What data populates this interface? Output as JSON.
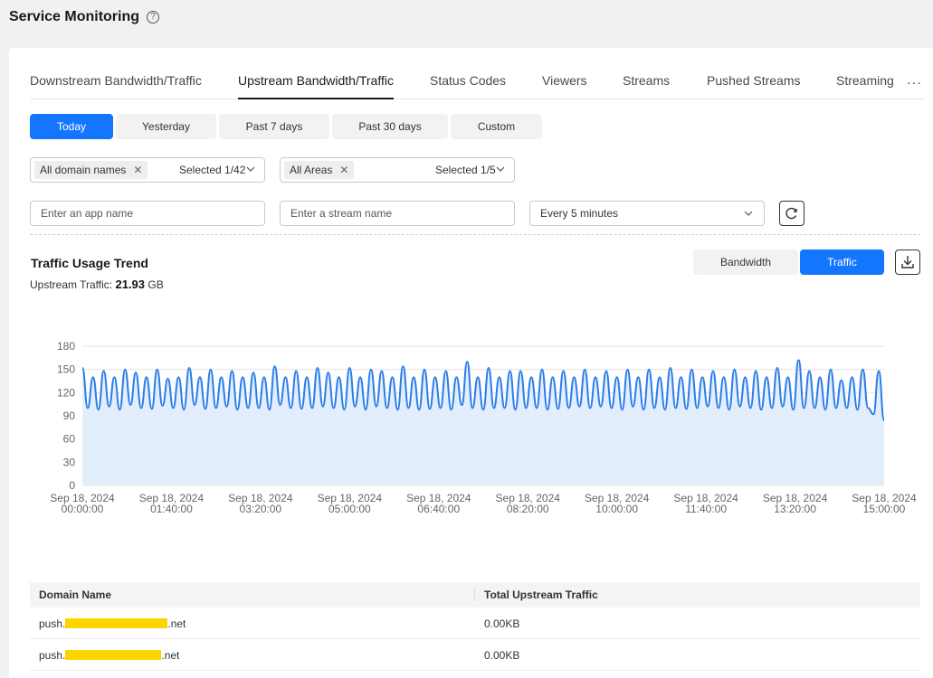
{
  "header": {
    "title": "Service Monitoring",
    "help_icon": "?"
  },
  "tabs": [
    {
      "label": "Downstream Bandwidth/Traffic",
      "active": false
    },
    {
      "label": "Upstream Bandwidth/Traffic",
      "active": true
    },
    {
      "label": "Status Codes",
      "active": false
    },
    {
      "label": "Viewers",
      "active": false
    },
    {
      "label": "Streams",
      "active": false
    },
    {
      "label": "Pushed Streams",
      "active": false
    },
    {
      "label": "Streaming",
      "active": false
    }
  ],
  "tabs_more": "···",
  "date_ranges": [
    {
      "label": "Today",
      "active": true
    },
    {
      "label": "Yesterday",
      "active": false
    },
    {
      "label": "Past 7 days",
      "active": false
    },
    {
      "label": "Past 30 days",
      "active": false
    },
    {
      "label": "Custom",
      "active": false
    }
  ],
  "filters": {
    "domain": {
      "tag": "All domain names",
      "selected": "Selected 1/42"
    },
    "area": {
      "tag": "All Areas",
      "selected": "Selected 1/5"
    },
    "app_placeholder": "Enter an app name",
    "stream_placeholder": "Enter a stream name",
    "interval": "Every 5 minutes"
  },
  "chart_section": {
    "title": "Traffic Usage Trend",
    "summary_label": "Upstream Traffic:",
    "summary_value": "21.93",
    "summary_unit": "GB",
    "toggle": [
      {
        "label": "Bandwidth",
        "active": false
      },
      {
        "label": "Traffic",
        "active": true
      }
    ]
  },
  "chart_data": {
    "type": "area",
    "title": "",
    "xlabel": "",
    "ylabel": "",
    "ylim": [
      0,
      180
    ],
    "yticks": [
      0,
      30,
      60,
      90,
      120,
      150,
      180
    ],
    "xticks": [
      {
        "date": "Sep 18, 2024",
        "time": "00:00:00"
      },
      {
        "date": "Sep 18, 2024",
        "time": "01:40:00"
      },
      {
        "date": "Sep 18, 2024",
        "time": "03:20:00"
      },
      {
        "date": "Sep 18, 2024",
        "time": "05:00:00"
      },
      {
        "date": "Sep 18, 2024",
        "time": "06:40:00"
      },
      {
        "date": "Sep 18, 2024",
        "time": "08:20:00"
      },
      {
        "date": "Sep 18, 2024",
        "time": "10:00:00"
      },
      {
        "date": "Sep 18, 2024",
        "time": "11:40:00"
      },
      {
        "date": "Sep 18, 2024",
        "time": "13:20:00"
      },
      {
        "date": "Sep 18, 2024",
        "time": "15:00:00"
      }
    ],
    "x_range": [
      "Sep 18, 2024 00:00:00",
      "Sep 18, 2024 15:00:00"
    ],
    "x_interval": "5 minutes",
    "grid": true,
    "color": "#2b7de9",
    "fill": "#e3eefc",
    "series": [
      {
        "values": [
          152,
          100,
          140,
          98,
          148,
          102,
          140,
          98,
          150,
          104,
          146,
          100,
          140,
          99,
          150,
          103,
          138,
          100,
          140,
          98,
          152,
          104,
          140,
          99,
          150,
          100,
          140,
          102,
          148,
          98,
          140,
          100,
          146,
          100,
          140,
          98,
          154,
          104,
          140,
          100,
          148,
          99,
          140,
          100,
          152,
          102,
          146,
          100,
          140,
          98,
          152,
          102,
          140,
          98,
          150,
          102,
          148,
          100,
          140,
          98,
          154,
          100,
          140,
          98,
          150,
          99,
          140,
          100,
          148,
          98,
          140,
          104,
          160,
          100,
          140,
          98,
          152,
          100,
          140,
          100,
          148,
          98,
          148,
          100,
          140,
          100,
          150,
          98,
          140,
          99,
          148,
          100,
          140,
          102,
          150,
          100,
          140,
          102,
          148,
          100,
          140,
          98,
          150,
          102,
          140,
          98,
          150,
          100,
          140,
          98,
          152,
          100,
          140,
          99,
          150,
          100,
          140,
          102,
          148,
          100,
          140,
          98,
          150,
          102,
          140,
          100,
          148,
          98,
          140,
          100,
          152,
          102,
          140,
          98,
          162,
          100,
          148,
          100,
          140,
          98,
          150,
          100,
          136,
          100,
          140,
          98,
          150,
          100,
          92,
          148,
          84
        ]
      }
    ]
  },
  "table": {
    "headers": [
      "Domain Name",
      "Total Upstream Traffic"
    ],
    "rows": [
      {
        "prefix": "push.",
        "suffix": ".net",
        "value": "0.00KB"
      },
      {
        "prefix": "push.",
        "suffix": ".net",
        "value": "0.00KB"
      }
    ]
  }
}
